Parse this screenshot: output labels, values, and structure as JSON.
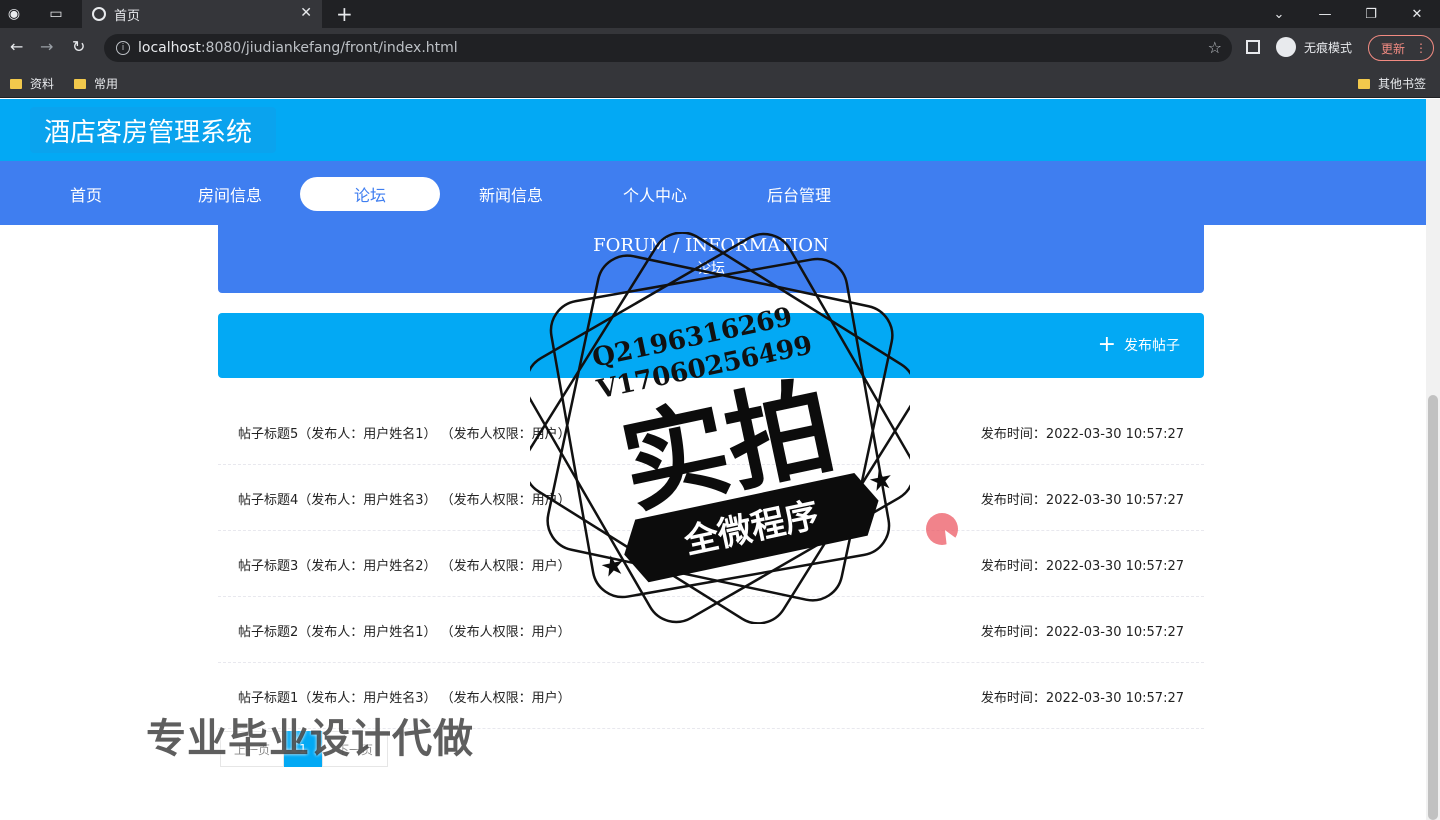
{
  "browser": {
    "tab_title": "首页",
    "url_host": "localhost",
    "url_rest": ":8080/jiudiankefang/front/index.html",
    "incognito_label": "无痕模式",
    "update_label": "更新",
    "bookmarks": [
      "资料",
      "常用"
    ],
    "other_bookmarks": "其他书签"
  },
  "site": {
    "logo": "酒店客房管理系统",
    "nav": [
      "首页",
      "房间信息",
      "论坛",
      "新闻信息",
      "个人中心",
      "后台管理"
    ],
    "active_nav": "论坛"
  },
  "forum": {
    "title_en": "FORUM / INFORMATION",
    "title_cn": "论坛",
    "publish_label": "发布帖子"
  },
  "posts": [
    {
      "title": "帖子标题5（发布人：用户姓名1） （发布人权限：用户）",
      "time": "发布时间：2022-03-30 10:57:27"
    },
    {
      "title": "帖子标题4（发布人：用户姓名3） （发布人权限：用户）",
      "time": "发布时间：2022-03-30 10:57:27"
    },
    {
      "title": "帖子标题3（发布人：用户姓名2） （发布人权限：用户）",
      "time": "发布时间：2022-03-30 10:57:27"
    },
    {
      "title": "帖子标题2（发布人：用户姓名1） （发布人权限：用户）",
      "time": "发布时间：2022-03-30 10:57:27"
    },
    {
      "title": "帖子标题1（发布人：用户姓名3） （发布人权限：用户）",
      "time": "发布时间：2022-03-30 10:57:27"
    }
  ],
  "pagination": {
    "prev": "上一页",
    "current": "1",
    "next": "下一页"
  },
  "watermark": {
    "line1": "Q2196316269",
    "line2": "V17060256499",
    "big": "实拍",
    "ribbon": "全微程序",
    "bottom": "专业毕业设计代做"
  }
}
